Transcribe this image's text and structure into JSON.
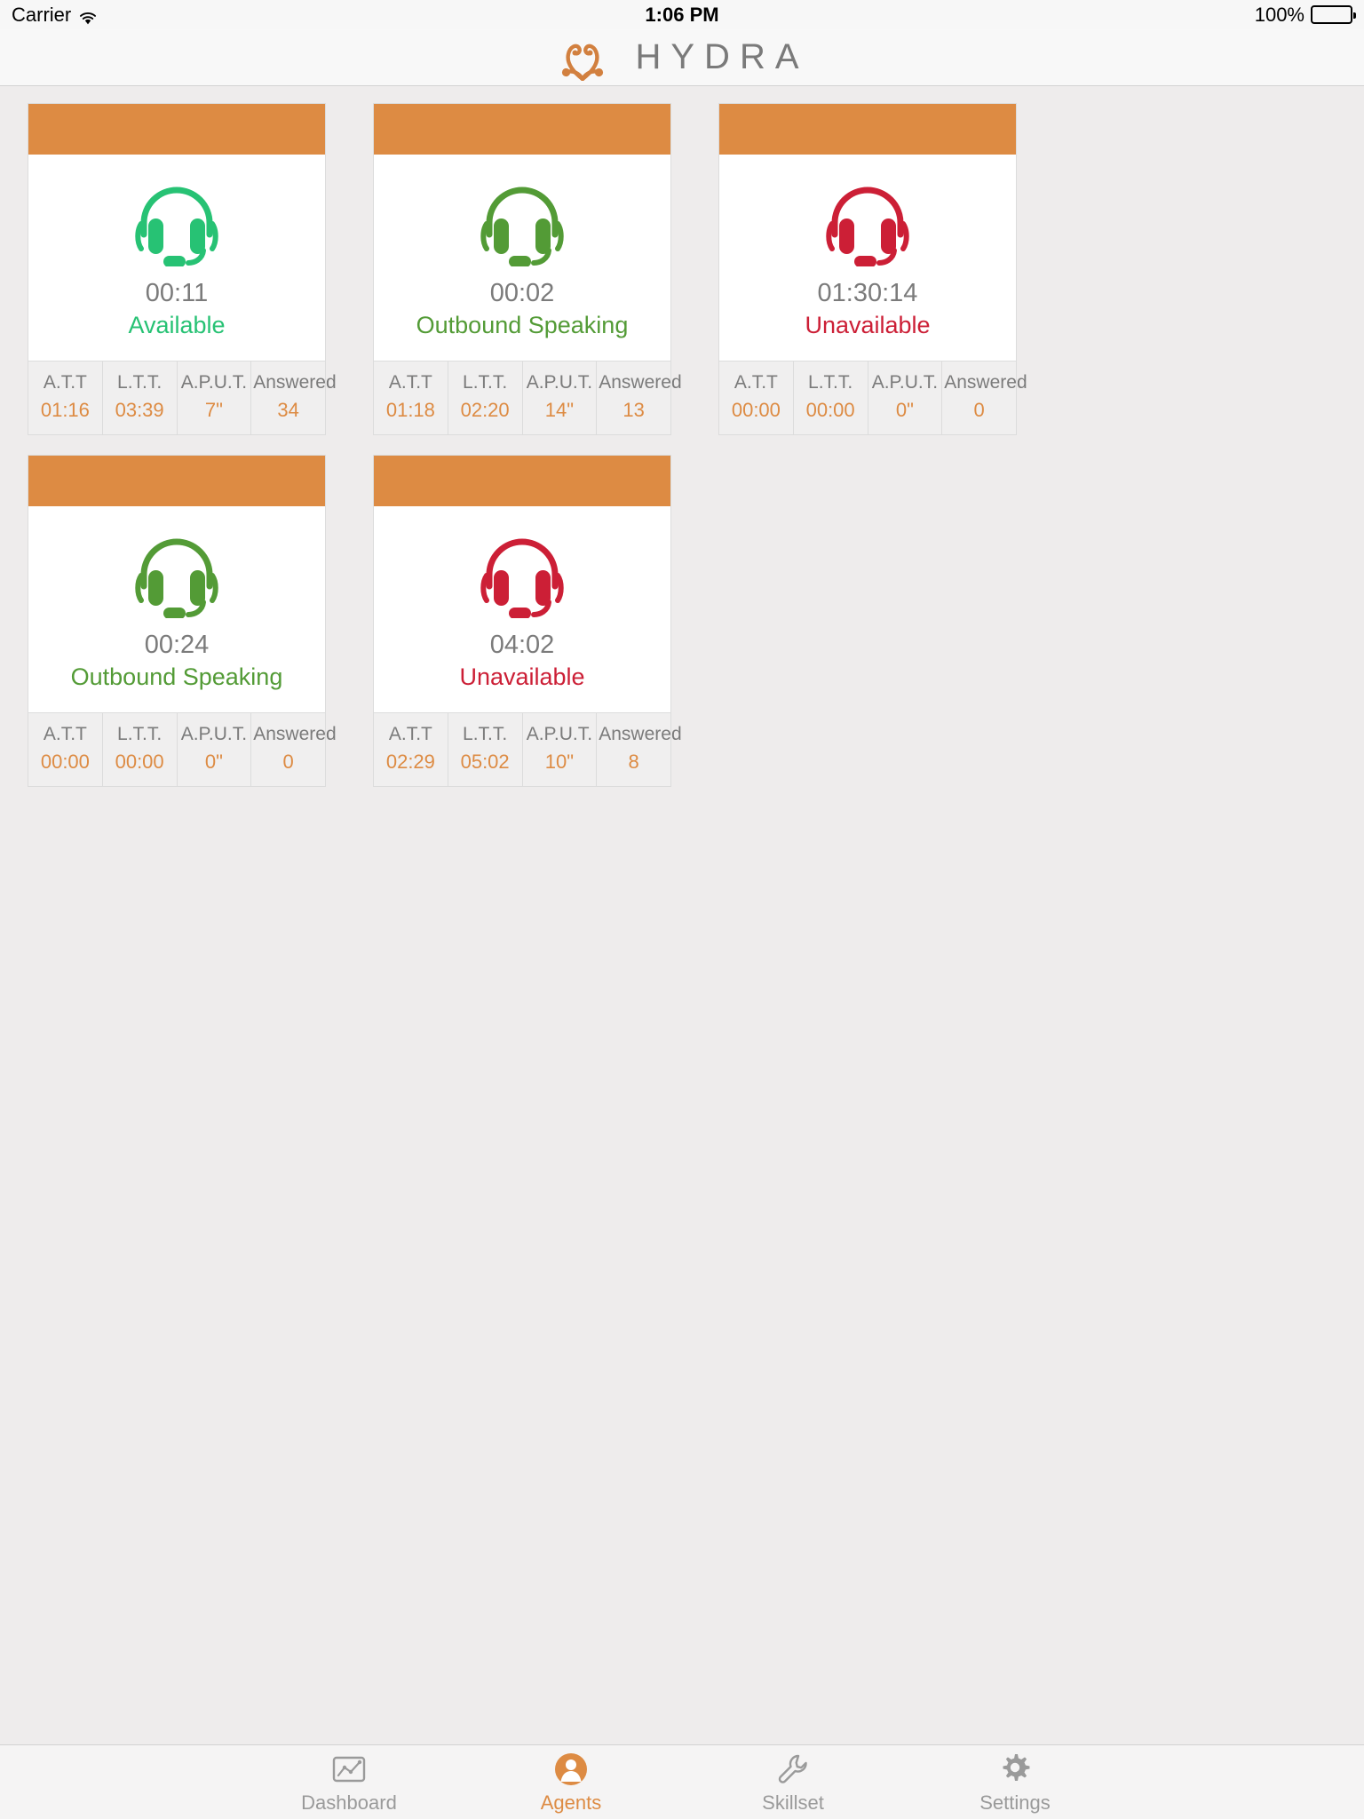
{
  "status_bar": {
    "carrier": "Carrier",
    "wifi_icon": "wifi-icon",
    "time": "1:06 PM",
    "battery_percent": "100%",
    "battery_icon": "battery-full-icon"
  },
  "header": {
    "logo_icon": "hydra-swirl-logo-icon",
    "brand": "HYDRA",
    "brand_color": "#7a7a7a",
    "accent_color": "#dd8b43"
  },
  "colors": {
    "accent_orange": "#dd8b43",
    "available_green": "#27c274",
    "outbound_green": "#539b36",
    "unavailable_red": "#cc1f36",
    "page_background": "#eeecec",
    "card_background": "#ffffff",
    "stats_background": "#f0efef"
  },
  "stat_labels": [
    "A.T.T",
    "L.T.T.",
    "A.P.U.T.",
    "Answered"
  ],
  "agents": [
    {
      "icon": "headset-icon",
      "timer": "00:11",
      "status": "Available",
      "status_color": "#27c274",
      "stats": [
        "01:16",
        "03:39",
        "7\"",
        "34"
      ]
    },
    {
      "icon": "headset-icon",
      "timer": "00:02",
      "status": "Outbound Speaking",
      "status_color": "#539b36",
      "stats": [
        "01:18",
        "02:20",
        "14\"",
        "13"
      ]
    },
    {
      "icon": "headset-icon",
      "timer": "01:30:14",
      "status": "Unavailable",
      "status_color": "#cc1f36",
      "stats": [
        "00:00",
        "00:00",
        "0\"",
        "0"
      ]
    },
    {
      "icon": "headset-icon",
      "timer": "00:24",
      "status": "Outbound Speaking",
      "status_color": "#539b36",
      "stats": [
        "00:00",
        "00:00",
        "0\"",
        "0"
      ]
    },
    {
      "icon": "headset-icon",
      "timer": "04:02",
      "status": "Unavailable",
      "status_color": "#cc1f36",
      "stats": [
        "02:29",
        "05:02",
        "10\"",
        "8"
      ]
    }
  ],
  "tab_bar": {
    "items": [
      {
        "label": "Dashboard",
        "icon": "dashboard-chart-icon",
        "active": false
      },
      {
        "label": "Agents",
        "icon": "agents-person-icon",
        "active": true
      },
      {
        "label": "Skillset",
        "icon": "skillset-wrench-icon",
        "active": false
      },
      {
        "label": "Settings",
        "icon": "settings-gear-icon",
        "active": false
      }
    ]
  }
}
